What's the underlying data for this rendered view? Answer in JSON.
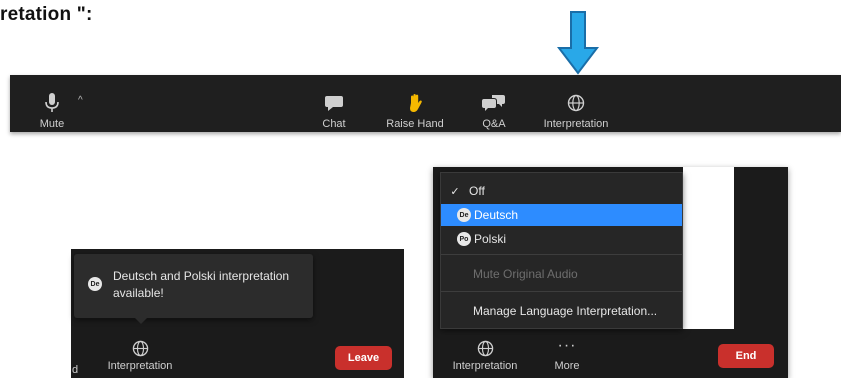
{
  "heading": "retation \":",
  "toolbar": {
    "mute_label": "Mute",
    "chat_label": "Chat",
    "raise_hand_label": "Raise Hand",
    "qa_label": "Q&A",
    "interpretation_label": "Interpretation"
  },
  "left_panel": {
    "tooltip_badge": "De",
    "tooltip_text": "Deutsch and Polski interpretation available!",
    "edge_label": "d",
    "interpretation_label": "Interpretation",
    "leave_label": "Leave"
  },
  "menu": {
    "off_label": "Off",
    "deutsch_badge": "De",
    "deutsch_label": "Deutsch",
    "polski_badge": "Po",
    "polski_label": "Polski",
    "mute_original_label": "Mute Original Audio",
    "manage_label": "Manage Language Interpretation..."
  },
  "right_panel": {
    "interpretation_label": "Interpretation",
    "more_label": "More",
    "end_label": "End"
  },
  "colors": {
    "toolbar_bg": "#1f1f1f",
    "accent_blue": "#2d8cff",
    "arrow_blue": "#29a8e8",
    "danger_red": "#c9302c",
    "raise_hand": "#f5b800"
  }
}
